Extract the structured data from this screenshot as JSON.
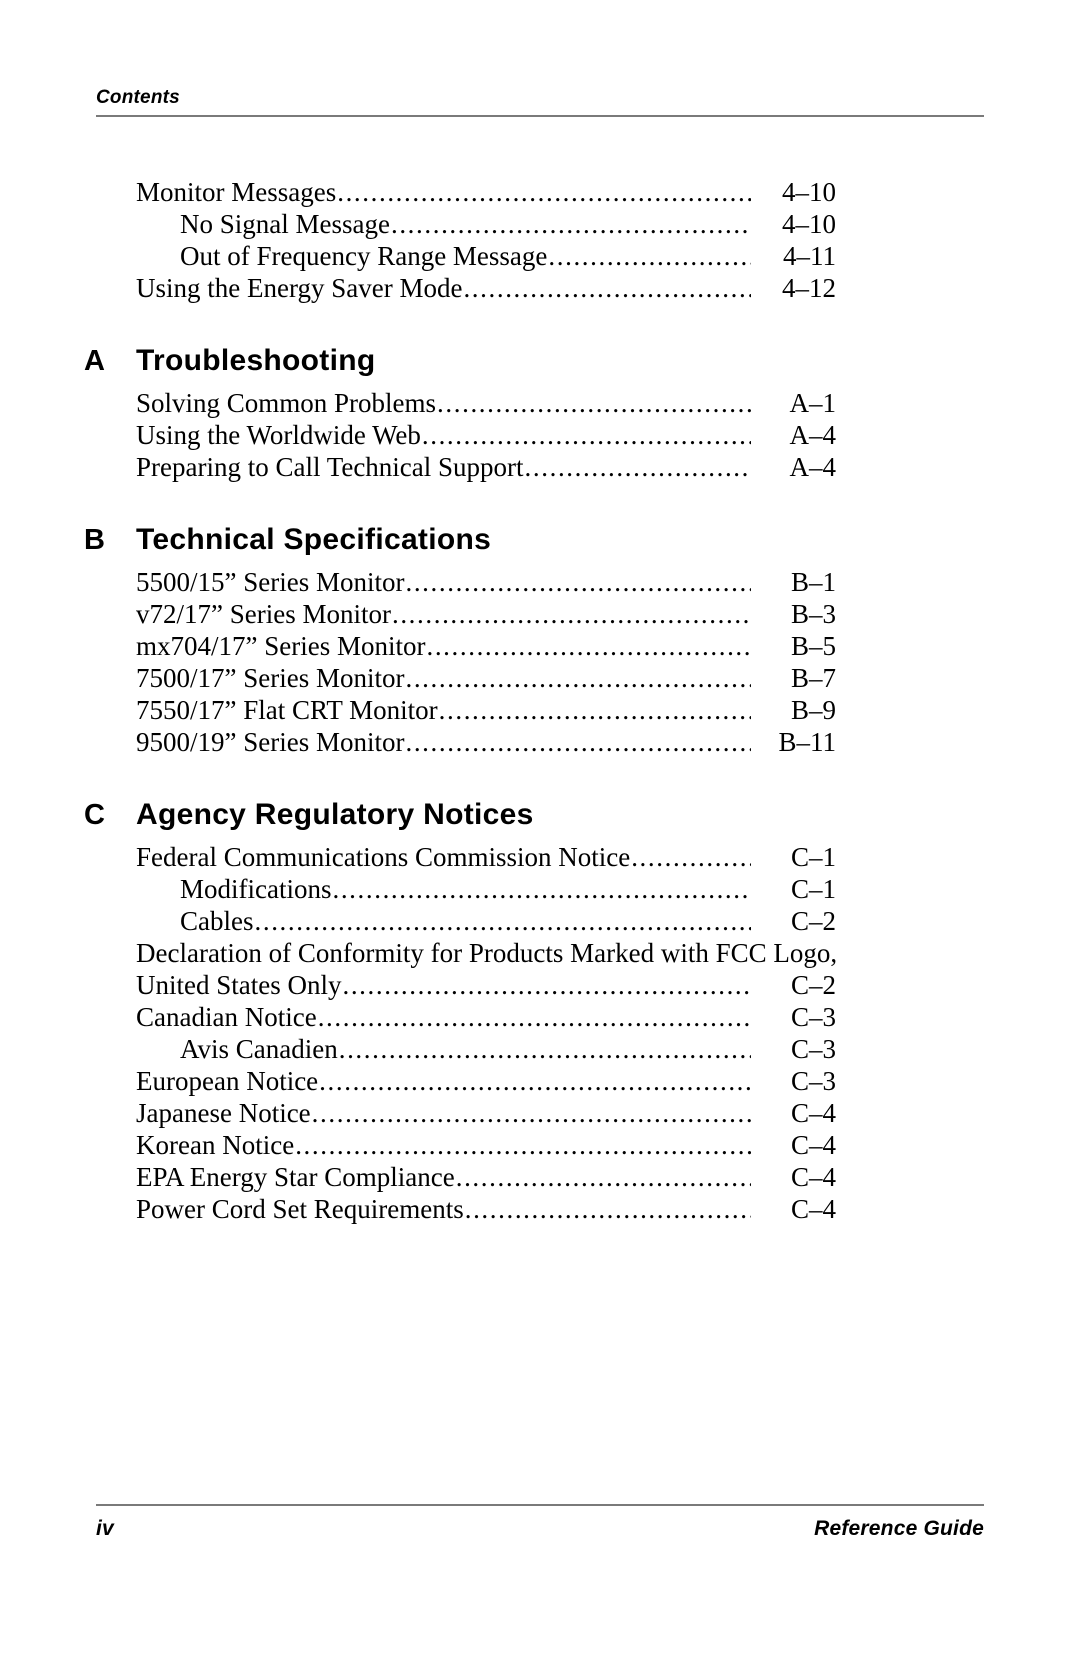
{
  "header": {
    "label": "Contents"
  },
  "footer": {
    "page_number": "iv",
    "guide_title": "Reference Guide"
  },
  "leader": "..................................................................................................",
  "sections": [
    {
      "id": "chapter-4-continued",
      "letter": "",
      "title": "",
      "entries": [
        {
          "level": 1,
          "text": "Monitor Messages",
          "page": "4–10"
        },
        {
          "level": 2,
          "text": "No Signal Message",
          "page": "4–10"
        },
        {
          "level": 2,
          "text": "Out of Frequency Range Message",
          "page": "4–11"
        },
        {
          "level": 1,
          "text": "Using the Energy Saver Mode",
          "page": "4–12"
        }
      ]
    },
    {
      "id": "appendix-a",
      "letter": "A",
      "title": "Troubleshooting",
      "entries": [
        {
          "level": 1,
          "text": "Solving Common Problems",
          "page": "A–1"
        },
        {
          "level": 1,
          "text": "Using the Worldwide Web",
          "page": "A–4"
        },
        {
          "level": 1,
          "text": "Preparing to Call Technical Support",
          "page": "A–4"
        }
      ]
    },
    {
      "id": "appendix-b",
      "letter": "B",
      "title": "Technical Specifications",
      "entries": [
        {
          "level": 1,
          "text": "5500/15” Series Monitor",
          "page": "B–1"
        },
        {
          "level": 1,
          "text": "v72/17” Series Monitor",
          "page": "B–3"
        },
        {
          "level": 1,
          "text": "mx704/17” Series Monitor",
          "page": "B–5"
        },
        {
          "level": 1,
          "text": "7500/17” Series Monitor",
          "page": "B–7"
        },
        {
          "level": 1,
          "text": "7550/17” Flat CRT Monitor",
          "page": "B–9"
        },
        {
          "level": 1,
          "text": "9500/19” Series Monitor",
          "page": "B–11"
        }
      ]
    },
    {
      "id": "appendix-c",
      "letter": "C",
      "title": "Agency Regulatory Notices",
      "entries": [
        {
          "level": 1,
          "text": "Federal Communications Commission Notice",
          "page": "C–1"
        },
        {
          "level": 2,
          "text": "Modifications",
          "page": "C–1"
        },
        {
          "level": 2,
          "text": "Cables",
          "page": "C–2"
        },
        {
          "level": 1,
          "text": "Declaration of Conformity for Products Marked with FCC Logo,",
          "page": "",
          "wrapped": true
        },
        {
          "level": 1,
          "text": "United States Only",
          "page": "C–2"
        },
        {
          "level": 1,
          "text": "Canadian Notice",
          "page": "C–3"
        },
        {
          "level": 2,
          "text": "Avis Canadien",
          "page": "C–3"
        },
        {
          "level": 1,
          "text": "European Notice",
          "page": "C–3"
        },
        {
          "level": 1,
          "text": "Japanese Notice",
          "page": "C–4"
        },
        {
          "level": 1,
          "text": "Korean Notice",
          "page": "C–4"
        },
        {
          "level": 1,
          "text": "EPA Energy Star Compliance",
          "page": "C–4"
        },
        {
          "level": 1,
          "text": "Power Cord Set Requirements",
          "page": "C–4"
        }
      ]
    }
  ]
}
